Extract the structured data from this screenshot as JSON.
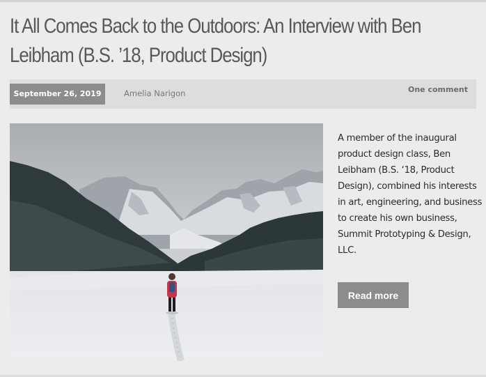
{
  "post": {
    "title": "It All Comes Back to the Outdoors: An Interview with Ben Leibham (B.S. ’18, Product Design)",
    "date": "September 26, 2019",
    "author": "Amelia Narigon",
    "comments": "One comment",
    "excerpt": "A member of the inaugural product design class, Ben Leibham (B.S. ‘18, Product Design), combined his interests in art, engineering, and business to create his own business, Summit Prototyping & Design, LLC.",
    "read_more": "Read more"
  },
  "colors": {
    "background": "#ececec",
    "meta_bar": "#dddddd",
    "date_badge": "#8c8c8c",
    "button": "#8c8c8c",
    "title_text": "#585858"
  }
}
